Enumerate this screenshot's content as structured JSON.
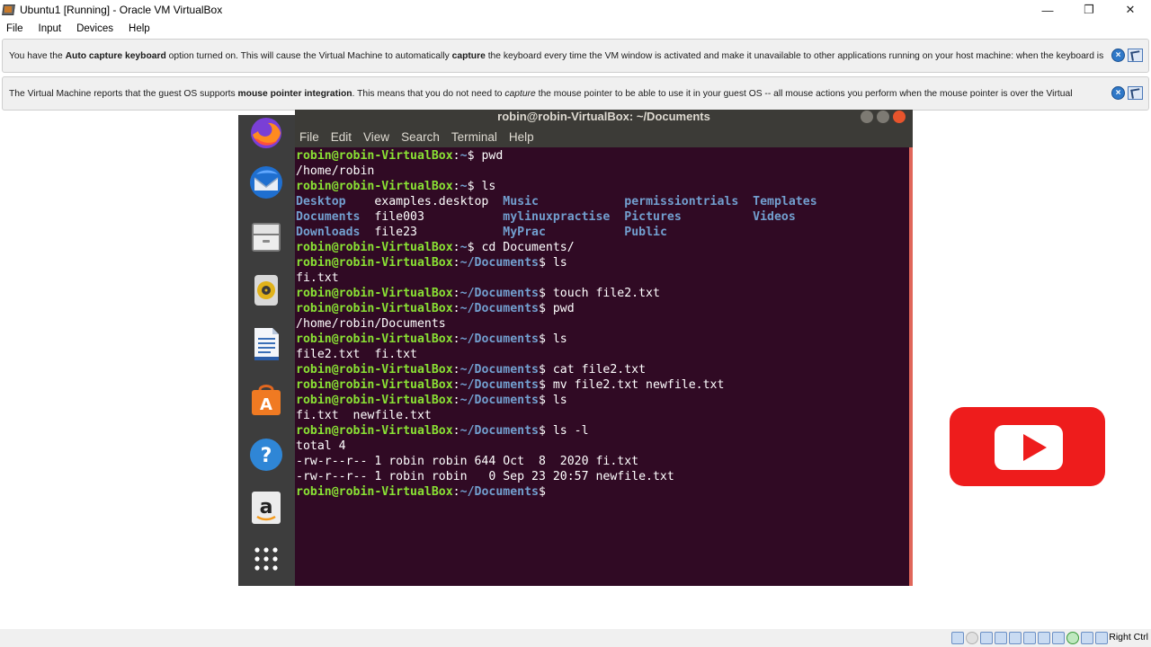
{
  "window": {
    "title": "Ubuntu1 [Running] - Oracle VM VirtualBox",
    "minimize_icon": "—",
    "restore_icon": "❐",
    "close_icon": "✕"
  },
  "menubar": [
    "File",
    "Input",
    "Devices",
    "Help"
  ],
  "notices": [
    {
      "pre": "You have the ",
      "b1": "Auto capture keyboard",
      "mid": " option turned on. This will cause the Virtual Machine to automatically ",
      "b2": "capture",
      "post": " the keyboard every time the VM window is activated and make it unavailable to other applications running on your host machine: when the keyboard is"
    },
    {
      "pre": "The Virtual Machine reports that the guest OS supports ",
      "b1": "mouse pointer integration",
      "mid": ". This means that you do not need to ",
      "b2": "capture",
      "post": " the mouse pointer to be able to use it in your guest OS -- all mouse actions you perform when the mouse pointer is over the Virtual"
    }
  ],
  "terminal": {
    "title": "robin@robin-VirtualBox: ~/Documents",
    "menu": [
      "File",
      "Edit",
      "View",
      "Search",
      "Terminal",
      "Help"
    ],
    "prompt_user": "robin@robin-VirtualBox",
    "lines": [
      {
        "type": "cmd",
        "path": "~",
        "cmd": " pwd"
      },
      {
        "type": "out",
        "text": "/home/robin"
      },
      {
        "type": "cmd",
        "path": "~",
        "cmd": " ls"
      },
      {
        "type": "ls",
        "cols": [
          [
            "Desktop",
            "dir"
          ],
          [
            "examples.desktop",
            "file"
          ],
          [
            "Music",
            "dir"
          ],
          [
            "permissiontrials",
            "dir"
          ],
          [
            "Templates",
            "dir"
          ]
        ]
      },
      {
        "type": "ls",
        "cols": [
          [
            "Documents",
            "dir"
          ],
          [
            "file003",
            "file"
          ],
          [
            "mylinuxpractise",
            "dir"
          ],
          [
            "Pictures",
            "dir"
          ],
          [
            "Videos",
            "dir"
          ]
        ]
      },
      {
        "type": "ls",
        "cols": [
          [
            "Downloads",
            "dir"
          ],
          [
            "file23",
            "file"
          ],
          [
            "MyPrac",
            "dir"
          ],
          [
            "Public",
            "dir"
          ],
          [
            "",
            "file"
          ]
        ]
      },
      {
        "type": "cmd",
        "path": "~",
        "cmd": " cd Documents/"
      },
      {
        "type": "cmd",
        "path": "~/Documents",
        "cmd": " ls"
      },
      {
        "type": "out",
        "text": "fi.txt"
      },
      {
        "type": "cmd",
        "path": "~/Documents",
        "cmd": " touch file2.txt"
      },
      {
        "type": "cmd",
        "path": "~/Documents",
        "cmd": " pwd"
      },
      {
        "type": "out",
        "text": "/home/robin/Documents"
      },
      {
        "type": "cmd",
        "path": "~/Documents",
        "cmd": " ls"
      },
      {
        "type": "out",
        "text": "file2.txt  fi.txt"
      },
      {
        "type": "cmd",
        "path": "~/Documents",
        "cmd": " cat file2.txt"
      },
      {
        "type": "cmd",
        "path": "~/Documents",
        "cmd": " mv file2.txt newfile.txt"
      },
      {
        "type": "cmd",
        "path": "~/Documents",
        "cmd": " ls"
      },
      {
        "type": "out",
        "text": "fi.txt  newfile.txt"
      },
      {
        "type": "cmd",
        "path": "~/Documents",
        "cmd": " ls -l"
      },
      {
        "type": "out",
        "text": "total 4"
      },
      {
        "type": "out",
        "text": "-rw-r--r-- 1 robin robin 644 Oct  8  2020 fi.txt"
      },
      {
        "type": "out",
        "text": "-rw-r--r-- 1 robin robin   0 Sep 23 20:57 newfile.txt"
      },
      {
        "type": "cmd",
        "path": "~/Documents",
        "cmd": ""
      }
    ]
  },
  "dock_icons": [
    "firefox-icon",
    "thunderbird-icon",
    "files-icon",
    "rhythmbox-icon",
    "libreoffice-writer-icon",
    "ubuntu-software-icon",
    "help-icon",
    "amazon-icon",
    "show-applications-icon"
  ],
  "statusbar": {
    "host_key": "Right Ctrl"
  },
  "colors": {
    "terminal_bg": "#300a24",
    "prompt_green": "#8ae234",
    "prompt_blue": "#729fcf",
    "youtube_red": "#ee1c1c"
  }
}
